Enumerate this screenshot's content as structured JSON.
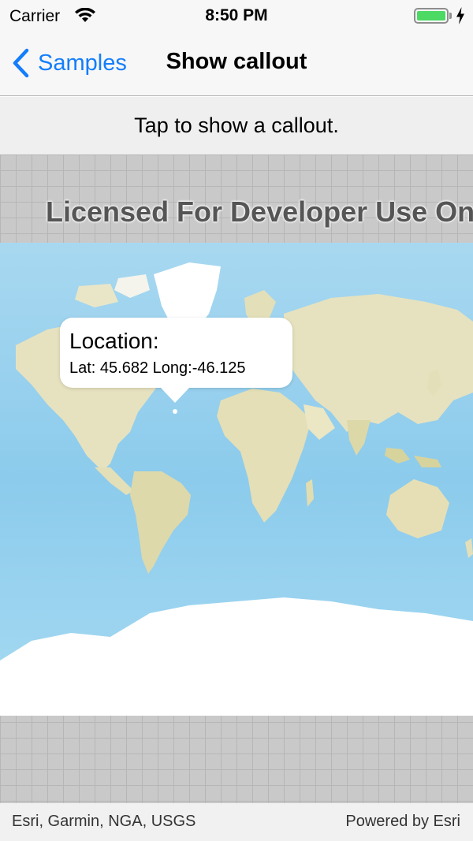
{
  "status_bar": {
    "carrier": "Carrier",
    "time": "8:50 PM",
    "battery_level": 1.0,
    "battery_color": "#4cd964",
    "wifi_icon": "wifi-icon",
    "charging_icon": "bolt-icon"
  },
  "nav_bar": {
    "back_label": "Samples",
    "back_icon": "chevron-left-icon",
    "title": "Show callout",
    "accent_color": "#147efb"
  },
  "instruction": {
    "text": "Tap to show a callout."
  },
  "map": {
    "watermark": "Licensed For Developer Use Only",
    "basemap": "world-imagery-topographic",
    "ocean_color": "#9fd4ef",
    "land_color": "#e8e4c4"
  },
  "callout": {
    "title": "Location:",
    "detail": "Lat: 45.682 Long:-46.125"
  },
  "attribution": {
    "text": "Esri, Garmin, NGA, USGS",
    "powered_by": "Powered by Esri"
  }
}
